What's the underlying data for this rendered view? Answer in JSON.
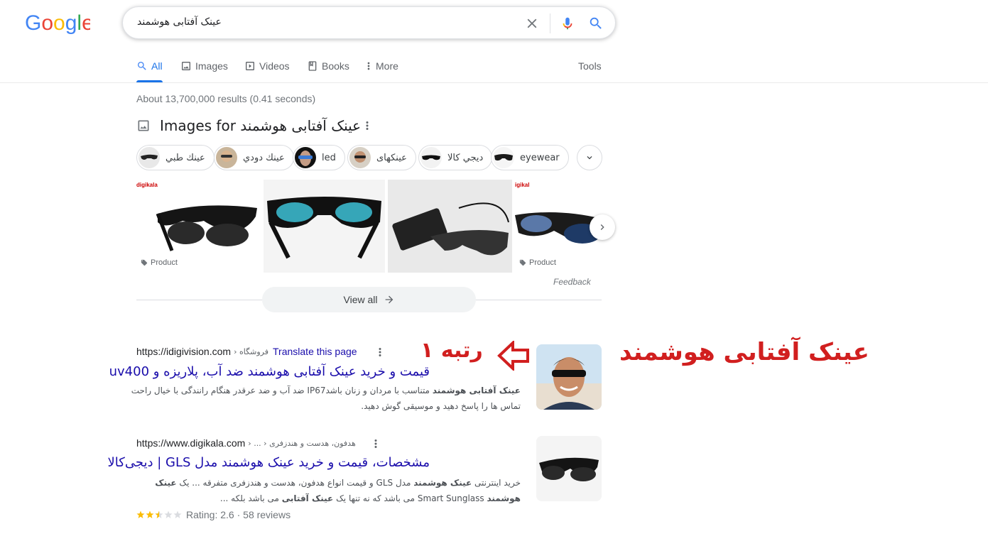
{
  "search": {
    "query": "عینک آفتابی هوشمند",
    "logo_text": "Google"
  },
  "tabs": [
    {
      "label": "All",
      "icon": "search-icon",
      "active": true
    },
    {
      "label": "Images",
      "icon": "image-icon"
    },
    {
      "label": "Videos",
      "icon": "video-icon"
    },
    {
      "label": "Books",
      "icon": "book-icon"
    },
    {
      "label": "More",
      "icon": "dots-vertical-icon"
    }
  ],
  "tools_label": "Tools",
  "stats": "About 13,700,000 results (0.41 seconds)",
  "images_section": {
    "title": "Images for عینک آفتابی هوشمند",
    "chips": [
      "عينك طبي",
      "عينك دودي",
      "led",
      "عینکهای",
      "ديجي كالا",
      "eyewear"
    ],
    "tiles": [
      {
        "site": "digikala",
        "tag": "Product"
      },
      {
        "site": "",
        "tag": ""
      },
      {
        "site": "",
        "tag": ""
      },
      {
        "site": "igikal",
        "tag": "Product"
      }
    ],
    "feedback": "Feedback",
    "view_all": "View all"
  },
  "results": [
    {
      "url": "https://idigivision.com",
      "breadcrumb": "› فروشگاه",
      "translate": "Translate this page",
      "title": "قیمت و خرید عینک آفتابی هوشمند ضد آب، پلاریزه و uv400",
      "snippet_bold": "عینک آفتابی هوشمند",
      "snippet": " متناسب با مردان و زنان باشدIP67 ضد آب و ضد عرقدر هنگام رانندگی با خیال راحت تماس ها را پاسخ دهید و موسیقی گوش دهید."
    },
    {
      "url": "https://www.digikala.com",
      "breadcrumb": "› ... › هدفون، هدست و هندزفری",
      "title": "مشخصات، قیمت و خرید عینک هوشمند مدل GLS | دیجی‌کالا",
      "snippet_pre": "خرید اینترنتی ",
      "snippet_bold1": "عینک هوشمند",
      "snippet_mid": " مدل GLS و قیمت انواع هدفون، هدست و هندزفری متفرقه ... یک ",
      "snippet_bold2": "عینک هوشمند",
      "snippet_mid2": " Smart Sunglass می باشد که نه تنها یک ",
      "snippet_bold3": "عینک آفتابی",
      "snippet_end": " می باشد بلکه ...",
      "rating_text": "Rating: 2.6 · 58 reviews",
      "rating_value": 2.6
    }
  ],
  "annotation": {
    "title": "عینک آفتابی هوشمند",
    "rank": "رتبه ۱"
  },
  "colors": {
    "link": "#1a0dab",
    "accent": "#1a73e8",
    "annotation": "#d11f1f"
  }
}
